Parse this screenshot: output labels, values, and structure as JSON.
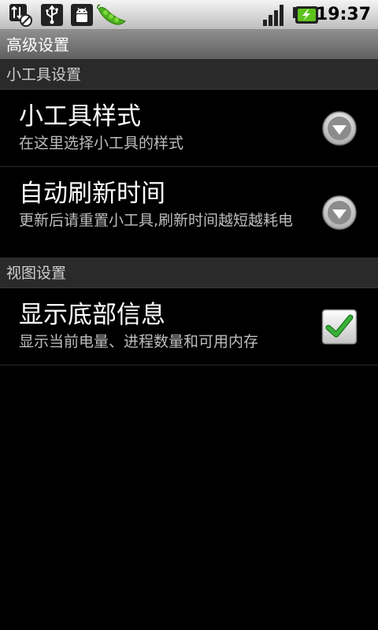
{
  "status_bar": {
    "time": "19:37",
    "icons": [
      "usb-debug-icon",
      "usb-icon",
      "android-icon",
      "pea-pod-icon",
      "signal-icon",
      "battery-icon"
    ]
  },
  "title_bar": {
    "title": "高级设置"
  },
  "sections": [
    {
      "header": "小工具设置",
      "items": [
        {
          "title": "小工具样式",
          "summary": "在这里选择小工具的样式",
          "widget": "dropdown"
        },
        {
          "title": "自动刷新时间",
          "summary": "更新后请重置小工具,刷新时间越短越耗电",
          "widget": "dropdown"
        }
      ]
    },
    {
      "header": "视图设置",
      "items": [
        {
          "title": "显示底部信息",
          "summary": "显示当前电量、进程数量和可用内存",
          "widget": "checkbox",
          "checked": true
        }
      ]
    }
  ],
  "colors": {
    "background": "#000000",
    "category_bg": "#2a2a2a",
    "check_green": "#3ab03a"
  }
}
